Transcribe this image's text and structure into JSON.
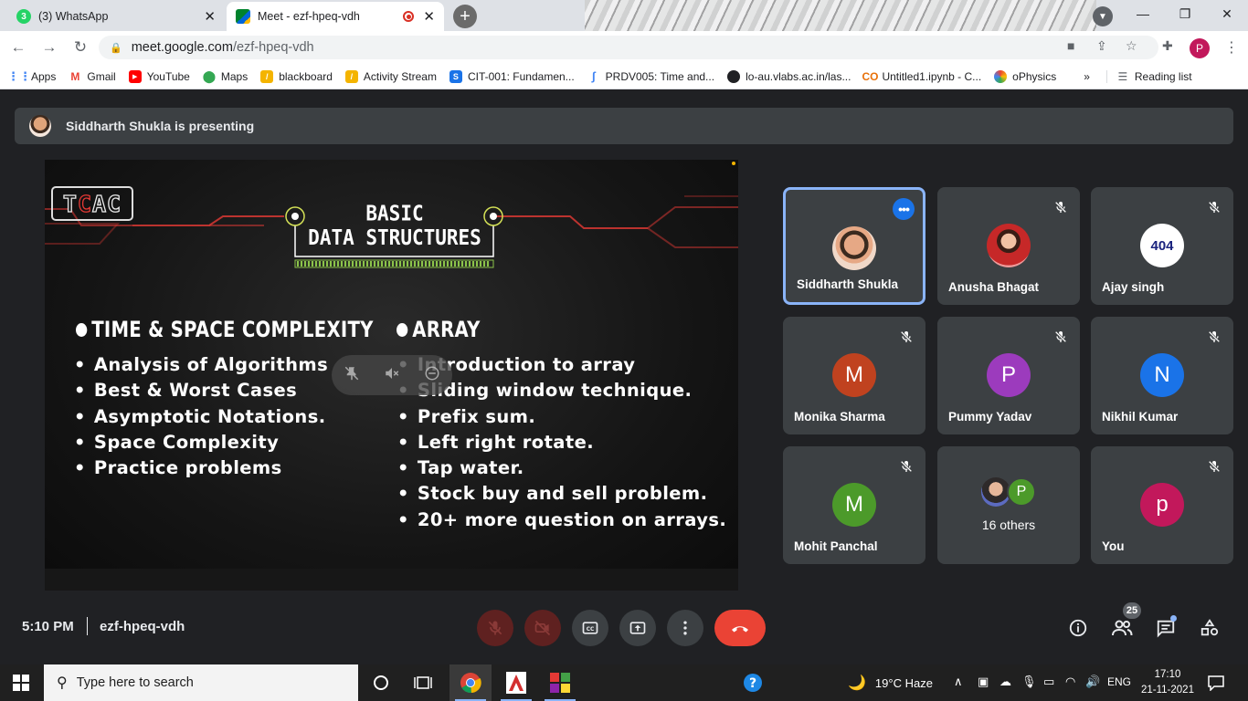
{
  "browser": {
    "tabs": [
      {
        "title": "(3) WhatsApp",
        "favicon": "whatsapp-icon",
        "active": false
      },
      {
        "title": "Meet - ezf-hpeq-vdh",
        "favicon": "meet-icon",
        "active": true,
        "recording": true
      }
    ],
    "url_host": "meet.google.com",
    "url_path": "/ezf-hpeq-vdh",
    "profile_initial": "P",
    "bookmarks": [
      {
        "label": "Apps",
        "icon": "apps-grid-icon",
        "color": "#4285f4"
      },
      {
        "label": "Gmail",
        "icon": "gmail-icon",
        "color": "#ea4335"
      },
      {
        "label": "YouTube",
        "icon": "youtube-icon",
        "color": "#ff0000"
      },
      {
        "label": "Maps",
        "icon": "maps-icon",
        "color": "#34a853"
      },
      {
        "label": "blackboard",
        "icon": "blackboard-icon",
        "color": "#f4b400"
      },
      {
        "label": "Activity Stream",
        "icon": "activity-icon",
        "color": "#f4b400"
      },
      {
        "label": "CIT-001: Fundamen...",
        "icon": "cit-icon",
        "color": "#1a73e8"
      },
      {
        "label": "PRDV005: Time and...",
        "icon": "prdv-icon",
        "color": "#4285f4"
      },
      {
        "label": "lo-au.vlabs.ac.in/las...",
        "icon": "globe-icon",
        "color": "#202124"
      },
      {
        "label": "Untitled1.ipynb - C...",
        "icon": "colab-icon",
        "color": "#e8710a"
      },
      {
        "label": "oPhysics",
        "icon": "ophysics-icon",
        "color": "#9c27b0"
      }
    ],
    "bookmarks_overflow": "»",
    "reading_list": "Reading list"
  },
  "meet": {
    "presenter_banner": "Siddharth Shukla is presenting",
    "slide": {
      "logo_text_1": "T",
      "logo_text_2": "C",
      "logo_text_3": "AC",
      "title_line1": "BASIC",
      "title_line2": "DATA STRUCTURES",
      "left_heading": "TIME & SPACE COMPLEXITY",
      "left_items": [
        "Analysis of Algorithms",
        "Best & Worst Cases",
        "Asymptotic Notations.",
        "Space Complexity",
        "Practice problems"
      ],
      "right_heading": "ARRAY",
      "right_items": [
        "Introduction to array",
        "Sliding window technique.",
        "Prefix sum.",
        "Left right rotate.",
        "Tap water.",
        "Stock buy and sell problem.",
        "20+ more question on arrays."
      ]
    },
    "participants": [
      {
        "name": "Siddharth Shukla",
        "avatar": "photo",
        "speaking": true
      },
      {
        "name": "Anusha Bhagat",
        "avatar": "photo",
        "muted": true
      },
      {
        "name": "Ajay singh",
        "avatar": "404",
        "muted": true
      },
      {
        "name": "Monika Sharma",
        "initial": "M",
        "color": "#c0421f",
        "muted": true
      },
      {
        "name": "Pummy Yadav",
        "initial": "P",
        "color": "#9c3bbd",
        "muted": true
      },
      {
        "name": "Nikhil Kumar",
        "initial": "N",
        "color": "#1a73e8",
        "muted": true
      },
      {
        "name": "Mohit Panchal",
        "initial": "M",
        "color": "#4c9a2a",
        "muted": true
      },
      {
        "name": "16 others",
        "initial": "P",
        "color": "#4c9a2a"
      },
      {
        "name": "You",
        "initial": "p",
        "color": "#c2185b",
        "muted": true
      }
    ],
    "ajay_avatar_text": "404",
    "time": "5:10 PM",
    "separator": "|",
    "meeting_code": "ezf-hpeq-vdh",
    "people_count": "25"
  },
  "taskbar": {
    "search_placeholder": "Type here to search",
    "weather": "19°C  Haze",
    "language": "ENG",
    "time": "17:10",
    "date": "21-11-2021"
  }
}
